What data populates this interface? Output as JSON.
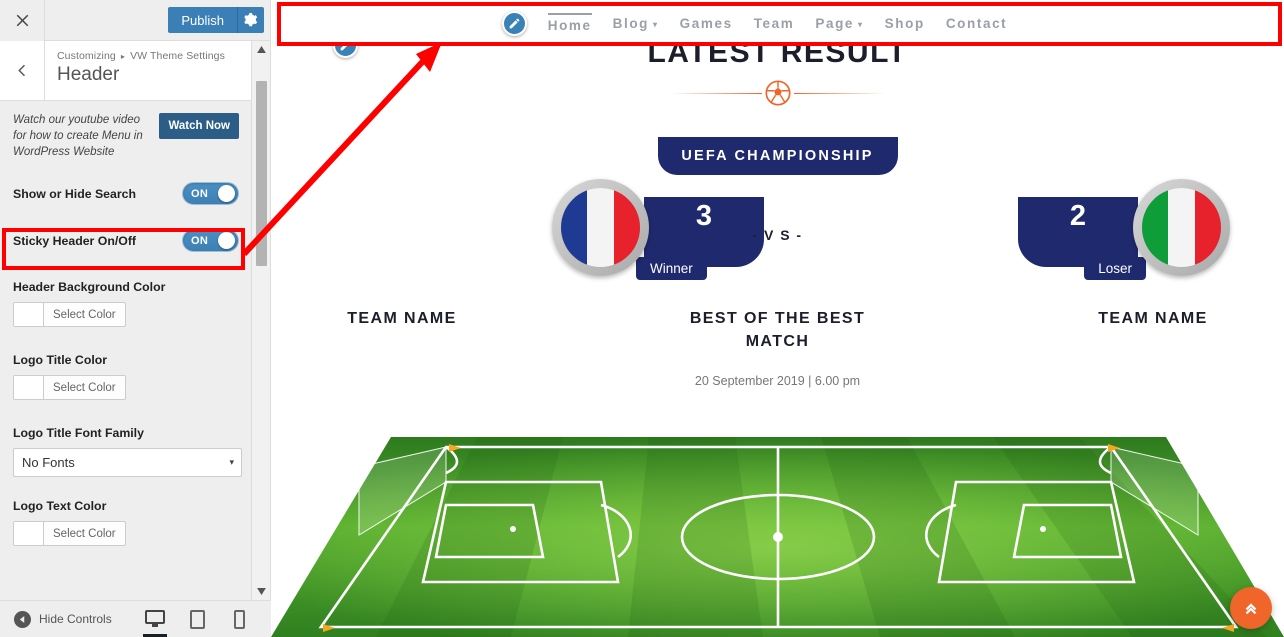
{
  "customizer": {
    "topbar": {
      "close_icon": "close-icon",
      "publish_label": "Publish",
      "gear_icon": "gear-icon"
    },
    "panel": {
      "back_icon": "chevron-left-icon",
      "breadcrumb_root": "Customizing",
      "breadcrumb_separator": "▸",
      "breadcrumb_parent": "VW Theme Settings",
      "title": "Header"
    },
    "notice": {
      "text": "Watch our youtube video for how to create Menu in WordPress Website",
      "button_label": "Watch Now"
    },
    "controls": [
      {
        "type": "toggle",
        "label": "Show or Hide Search",
        "value": "ON"
      },
      {
        "type": "toggle",
        "label": "Sticky Header On/Off",
        "value": "ON"
      },
      {
        "type": "color",
        "label": "Header Background Color",
        "button_label": "Select Color",
        "swatch": "#ffffff"
      },
      {
        "type": "color",
        "label": "Logo Title Color",
        "button_label": "Select Color",
        "swatch": "#ffffff"
      },
      {
        "type": "select",
        "label": "Logo Title Font Family",
        "value": "No Fonts",
        "caret": "▾"
      },
      {
        "type": "color",
        "label": "Logo Text Color",
        "button_label": "Select Color",
        "swatch": "#ffffff"
      }
    ],
    "footer": {
      "hide_controls_label": "Hide Controls",
      "devices": [
        {
          "name": "desktop",
          "active": true
        },
        {
          "name": "tablet",
          "active": false
        },
        {
          "name": "mobile",
          "active": false
        }
      ]
    },
    "scrollbar": {
      "up_icon": "caret-up-icon",
      "down_icon": "caret-down-icon"
    }
  },
  "preview": {
    "edit_shortcut_icon": "pencil-edit-icon",
    "nav": [
      {
        "label": "Home",
        "has_dropdown": false,
        "active": true
      },
      {
        "label": "Blog",
        "has_dropdown": true,
        "active": false
      },
      {
        "label": "Games",
        "has_dropdown": false,
        "active": false
      },
      {
        "label": "Team",
        "has_dropdown": false,
        "active": false
      },
      {
        "label": "Page",
        "has_dropdown": true,
        "active": false
      },
      {
        "label": "Shop",
        "has_dropdown": false,
        "active": false
      },
      {
        "label": "Contact",
        "has_dropdown": false,
        "active": false
      }
    ],
    "dropdown_caret": "▾",
    "section_title": "LATEST RESULT",
    "divider_icon": "soccer-ball-icon",
    "banner_label": "UEFA CHAMPIONSHIP",
    "match": {
      "home": {
        "score": "3",
        "tag": "Winner",
        "team_name": "TEAM NAME",
        "flag_colors": [
          "#1f3a93",
          "#f4f4f4",
          "#e8222c"
        ]
      },
      "away": {
        "score": "2",
        "tag": "Loser",
        "team_name": "TEAM NAME",
        "flag_colors": [
          "#0f9d3a",
          "#f4f4f4",
          "#e8222c"
        ]
      },
      "vs_label": "- V S -",
      "match_title": "BEST OF THE BEST MATCH",
      "date": "20 September 2019 | 6.00 pm"
    },
    "field_icon": "soccer-field-illustration",
    "scroll_top_icon": "double-chevron-up-icon"
  },
  "annotations": {
    "highlight_color": "#ff0000",
    "boxes": [
      "sticky-header-control",
      "site-header-area"
    ],
    "arrow": "points from sticky header control to the site header"
  }
}
